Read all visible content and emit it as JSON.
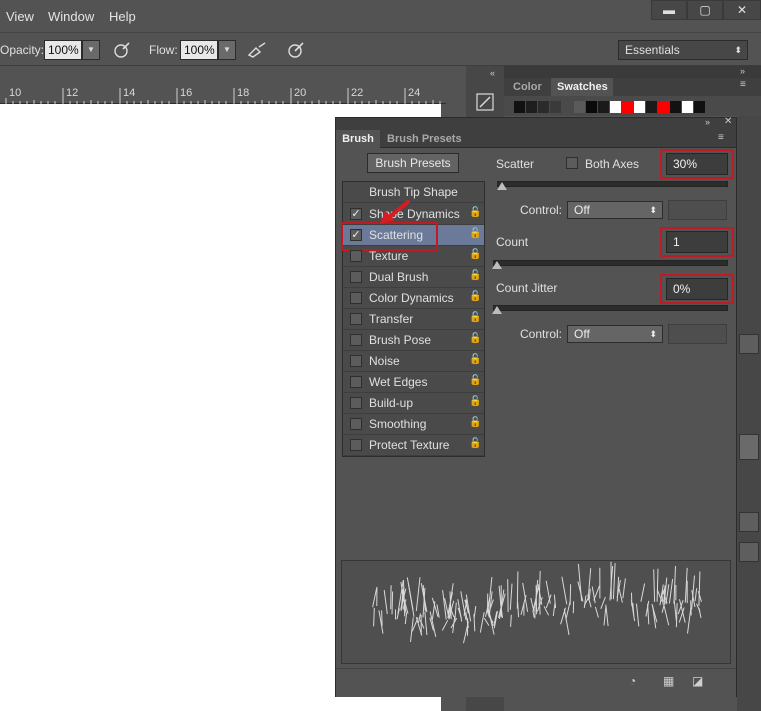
{
  "menu": {
    "items": [
      "View",
      "Window",
      "Help"
    ]
  },
  "window_controls": {
    "minimize": "▬",
    "restore": "▢",
    "close": "✕"
  },
  "options_bar": {
    "opacity_label": "Opacity:",
    "opacity_value": "100%",
    "flow_label": "Flow:",
    "flow_value": "100%",
    "workspace": "Essentials"
  },
  "ruler": {
    "labels": [
      "10",
      "12",
      "14",
      "16",
      "18",
      "20",
      "22",
      "24"
    ]
  },
  "color_panel": {
    "tabs": [
      "Color",
      "Swatches"
    ],
    "swatches": [
      "#111111",
      "#1e1e1e",
      "#2b2b2b",
      "#3a3a3a",
      "#4a4a4a",
      "#5a5a5a",
      "#0a0a0a",
      "#1a1a1a",
      "#ffffff",
      "#ff0000",
      "#ffffff",
      "#1a1a1a",
      "#ff0000",
      "#121212",
      "#ffffff",
      "#101010"
    ]
  },
  "brush_panel": {
    "tabs": [
      "Brush",
      "Brush Presets"
    ],
    "presets_button": "Brush Presets",
    "tip_shape": "Brush Tip Shape",
    "options": [
      {
        "label": "Shape Dynamics",
        "checked": true,
        "selected": false
      },
      {
        "label": "Scattering",
        "checked": true,
        "selected": true
      },
      {
        "label": "Texture",
        "checked": false,
        "selected": false
      },
      {
        "label": "Dual Brush",
        "checked": false,
        "selected": false
      },
      {
        "label": "Color Dynamics",
        "checked": false,
        "selected": false
      },
      {
        "label": "Transfer",
        "checked": false,
        "selected": false
      },
      {
        "label": "Brush Pose",
        "checked": false,
        "selected": false
      },
      {
        "label": "Noise",
        "checked": false,
        "selected": false
      },
      {
        "label": "Wet Edges",
        "checked": false,
        "selected": false
      },
      {
        "label": "Build-up",
        "checked": false,
        "selected": false
      },
      {
        "label": "Smoothing",
        "checked": false,
        "selected": false
      },
      {
        "label": "Protect Texture",
        "checked": false,
        "selected": false
      }
    ],
    "scatter_label": "Scatter",
    "both_axes_label": "Both Axes",
    "scatter_value": "30%",
    "control_label": "Control:",
    "control_value": "Off",
    "count_label": "Count",
    "count_value": "1",
    "count_jitter_label": "Count Jitter",
    "count_jitter_value": "0%",
    "control2_label": "Control:",
    "control2_value": "Off",
    "highlight_color": "#c01a24",
    "selected_row_color": "#6a7a98"
  }
}
